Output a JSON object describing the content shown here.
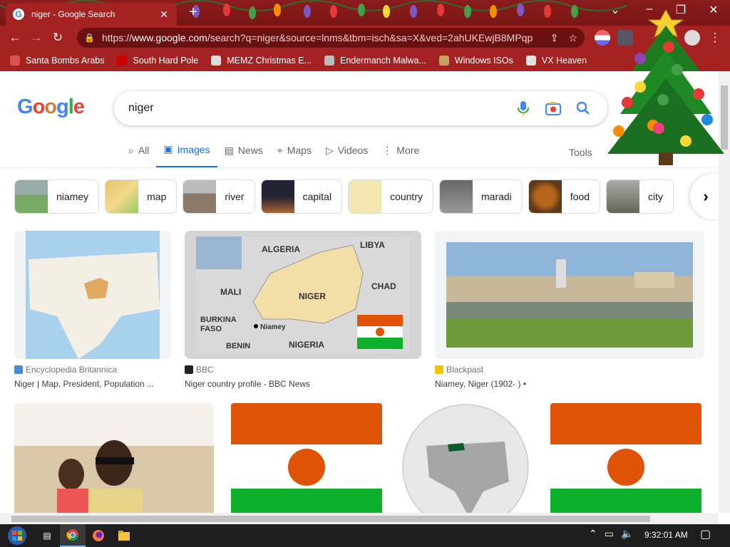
{
  "browser": {
    "tab_title": "niger - Google Search",
    "tab_close": "✕",
    "new_tab": "+",
    "url_prefix": "https://",
    "url_host": "www.google.com",
    "url_rest": "/search?q=niger&source=lnms&tbm=isch&sa=X&ved=2ahUKEwjB8MPqp",
    "bookmarks": [
      {
        "label": "Santa Bombs Arabs",
        "icon_color": "#d9534f"
      },
      {
        "label": "South Hard Pole",
        "icon_color": "#cc0000"
      },
      {
        "label": "MEMZ Christmas E...",
        "icon_color": "#dddddd"
      },
      {
        "label": "Endermanch Malwa...",
        "icon_color": "#bbbbbb"
      },
      {
        "label": "Windows ISOs",
        "icon_color": "#c8a060"
      },
      {
        "label": "VX Heaven",
        "icon_color": "#e0e0e0"
      }
    ]
  },
  "search": {
    "logo": "Google",
    "query": "niger",
    "tabs": [
      {
        "label": "All",
        "icon": "search-icon",
        "glyph": "⌕"
      },
      {
        "label": "Images",
        "icon": "image-icon",
        "glyph": "▣",
        "active": true
      },
      {
        "label": "News",
        "icon": "news-icon",
        "glyph": "▤"
      },
      {
        "label": "Maps",
        "icon": "map-pin-icon",
        "glyph": "⌖"
      },
      {
        "label": "Videos",
        "icon": "play-icon",
        "glyph": "▷"
      },
      {
        "label": "More",
        "icon": "more-dots-icon",
        "glyph": "⋮"
      }
    ],
    "tools": "Tools",
    "chips": [
      "niamey",
      "map",
      "river",
      "capital",
      "country",
      "maradi",
      "food",
      "city"
    ],
    "results": [
      {
        "source": "Encyclopedia Britannica",
        "title": "Niger | Map, President, Population ..."
      },
      {
        "source": "BBC",
        "title": "Niger country profile - BBC News"
      },
      {
        "source": "Blackpast",
        "title": "Niamey, Niger (1902- ) •"
      }
    ],
    "map_labels": {
      "algeria": "ALGERIA",
      "libya": "LIBYA",
      "mali": "MALI",
      "niger": "NIGER",
      "chad": "CHAD",
      "burkina": "BURKINA",
      "faso": "FASO",
      "niamey": "Niamey",
      "benin": "BENIN",
      "nigeria": "NIGERIA"
    }
  },
  "taskbar": {
    "clock": "9:32:01 AM"
  },
  "colors": {
    "google_blue": "#4285f4",
    "google_red": "#ea4335",
    "google_yellow": "#fbbc05",
    "google_green": "#34a853",
    "chrome_red": "#a52222",
    "niger_orange": "#e05206",
    "niger_green": "#0db02b"
  }
}
